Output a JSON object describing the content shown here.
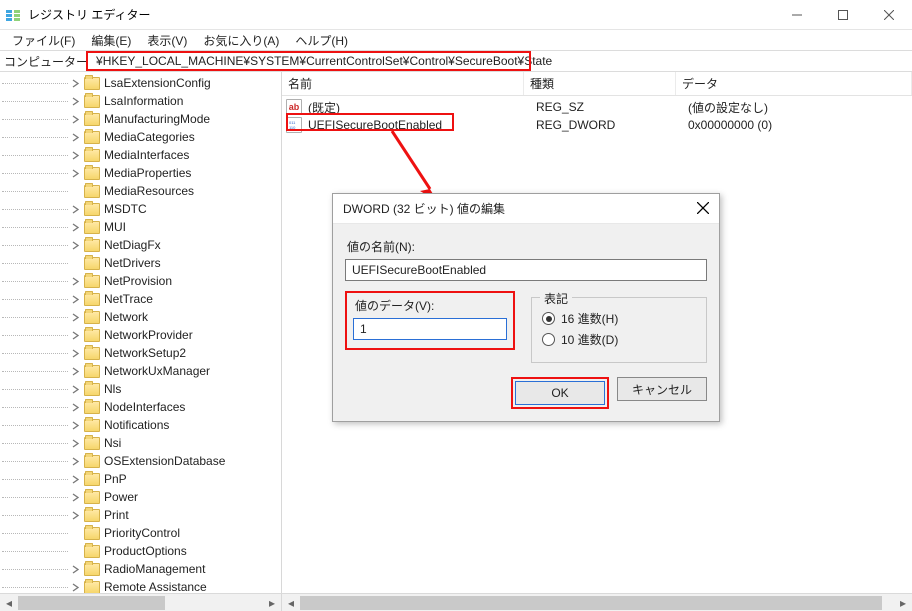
{
  "window": {
    "title": "レジストリ エディター"
  },
  "menu": {
    "file": "ファイル(F)",
    "edit": "編集(E)",
    "view": "表示(V)",
    "favorites": "お気に入り(A)",
    "help": "ヘルプ(H)"
  },
  "address": {
    "label": "コンピューター",
    "path": "¥HKEY_LOCAL_MACHINE¥SYSTEM¥CurrentControlSet¥Control¥SecureBoot¥State"
  },
  "tree": [
    {
      "label": "LsaExtensionConfig",
      "expandable": true
    },
    {
      "label": "LsaInformation",
      "expandable": true
    },
    {
      "label": "ManufacturingMode",
      "expandable": true
    },
    {
      "label": "MediaCategories",
      "expandable": true
    },
    {
      "label": "MediaInterfaces",
      "expandable": true
    },
    {
      "label": "MediaProperties",
      "expandable": true
    },
    {
      "label": "MediaResources",
      "expandable": false
    },
    {
      "label": "MSDTC",
      "expandable": true
    },
    {
      "label": "MUI",
      "expandable": true
    },
    {
      "label": "NetDiagFx",
      "expandable": true
    },
    {
      "label": "NetDrivers",
      "expandable": false
    },
    {
      "label": "NetProvision",
      "expandable": true
    },
    {
      "label": "NetTrace",
      "expandable": true
    },
    {
      "label": "Network",
      "expandable": true
    },
    {
      "label": "NetworkProvider",
      "expandable": true
    },
    {
      "label": "NetworkSetup2",
      "expandable": true
    },
    {
      "label": "NetworkUxManager",
      "expandable": true
    },
    {
      "label": "Nls",
      "expandable": true
    },
    {
      "label": "NodeInterfaces",
      "expandable": true
    },
    {
      "label": "Notifications",
      "expandable": true
    },
    {
      "label": "Nsi",
      "expandable": true
    },
    {
      "label": "OSExtensionDatabase",
      "expandable": true
    },
    {
      "label": "PnP",
      "expandable": true
    },
    {
      "label": "Power",
      "expandable": true
    },
    {
      "label": "Print",
      "expandable": true
    },
    {
      "label": "PriorityControl",
      "expandable": false
    },
    {
      "label": "ProductOptions",
      "expandable": false
    },
    {
      "label": "RadioManagement",
      "expandable": true
    },
    {
      "label": "Remote Assistance",
      "expandable": true
    }
  ],
  "list": {
    "columns": {
      "name": "名前",
      "type": "種類",
      "data": "データ"
    },
    "rows": [
      {
        "icon": "sz",
        "name": "(既定)",
        "type": "REG_SZ",
        "data": "(値の設定なし)"
      },
      {
        "icon": "dw",
        "name": "UEFISecureBootEnabled",
        "type": "REG_DWORD",
        "data": "0x00000000 (0)"
      }
    ]
  },
  "dialog": {
    "title": "DWORD (32 ビット) 値の編集",
    "name_label": "値の名前(N):",
    "name_value": "UEFISecureBootEnabled",
    "data_label": "値のデータ(V):",
    "data_value": "1",
    "base_label": "表記",
    "radio_hex": "16 進数(H)",
    "radio_dec": "10 進数(D)",
    "ok": "OK",
    "cancel": "キャンセル"
  },
  "icons": {
    "sz_glyph": "ab",
    "dw_glyph": "011\n110"
  }
}
